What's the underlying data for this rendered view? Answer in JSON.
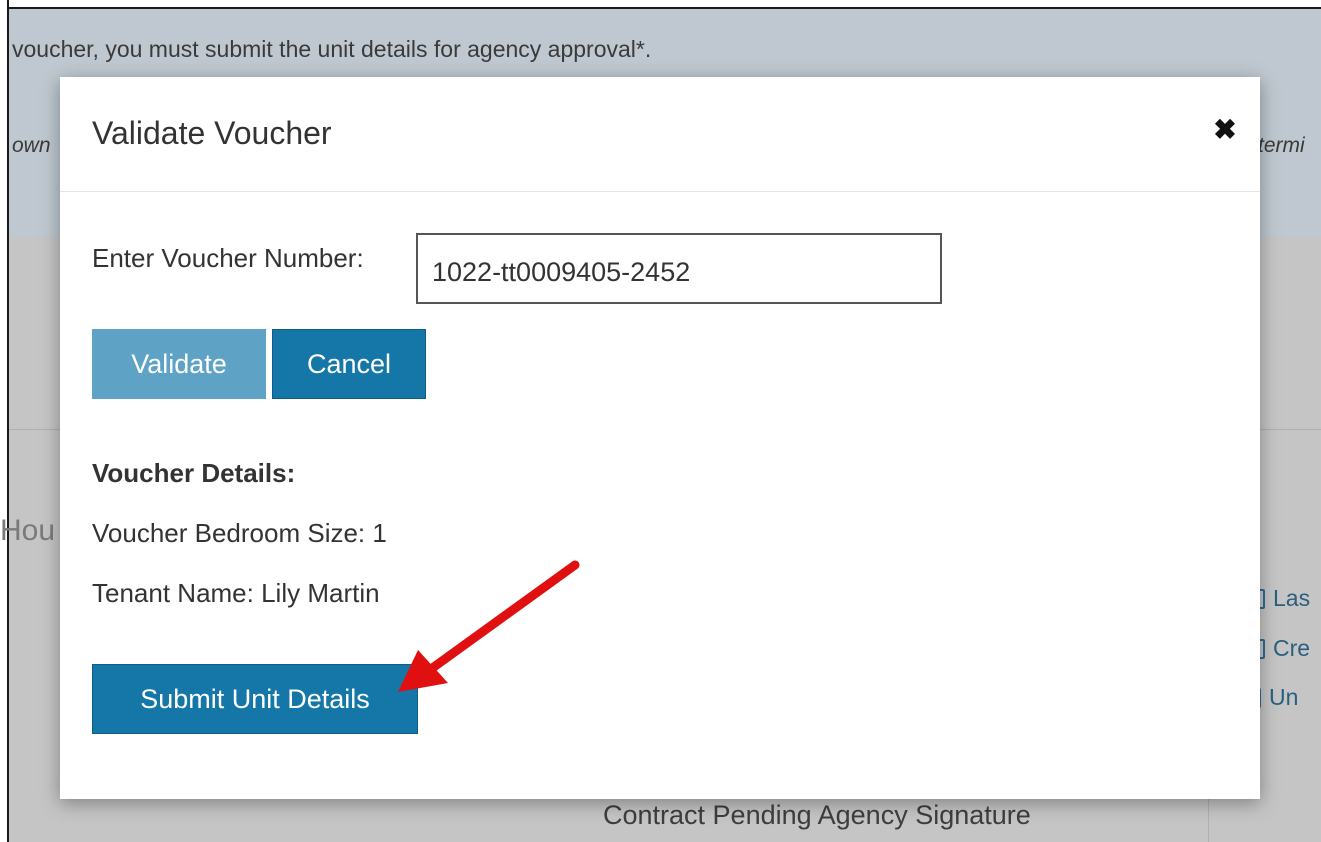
{
  "background": {
    "banner_text": "voucher, you must submit the unit details for agency approval*.",
    "banner_italic_left": "own",
    "banner_italic_right": "termi",
    "section_fragment": "Hou",
    "side_items": [
      "Las",
      "Cre",
      "Un"
    ],
    "status_text": "Contract Pending Agency Signature"
  },
  "modal": {
    "title": "Validate Voucher",
    "close_glyph": "✖",
    "voucher_label": "Enter Voucher Number:",
    "voucher_value": "1022-tt0009405-2452",
    "validate_label": "Validate",
    "cancel_label": "Cancel",
    "details_heading": "Voucher Details:",
    "bedroom_size": "Voucher Bedroom Size: 1",
    "tenant_name": "Tenant Name: Lily Martin",
    "submit_label": "Submit Unit Details"
  },
  "colors": {
    "primary_button": "#1477a8",
    "disabled_button": "#5ea3c6",
    "annotation_arrow": "#e01010"
  }
}
